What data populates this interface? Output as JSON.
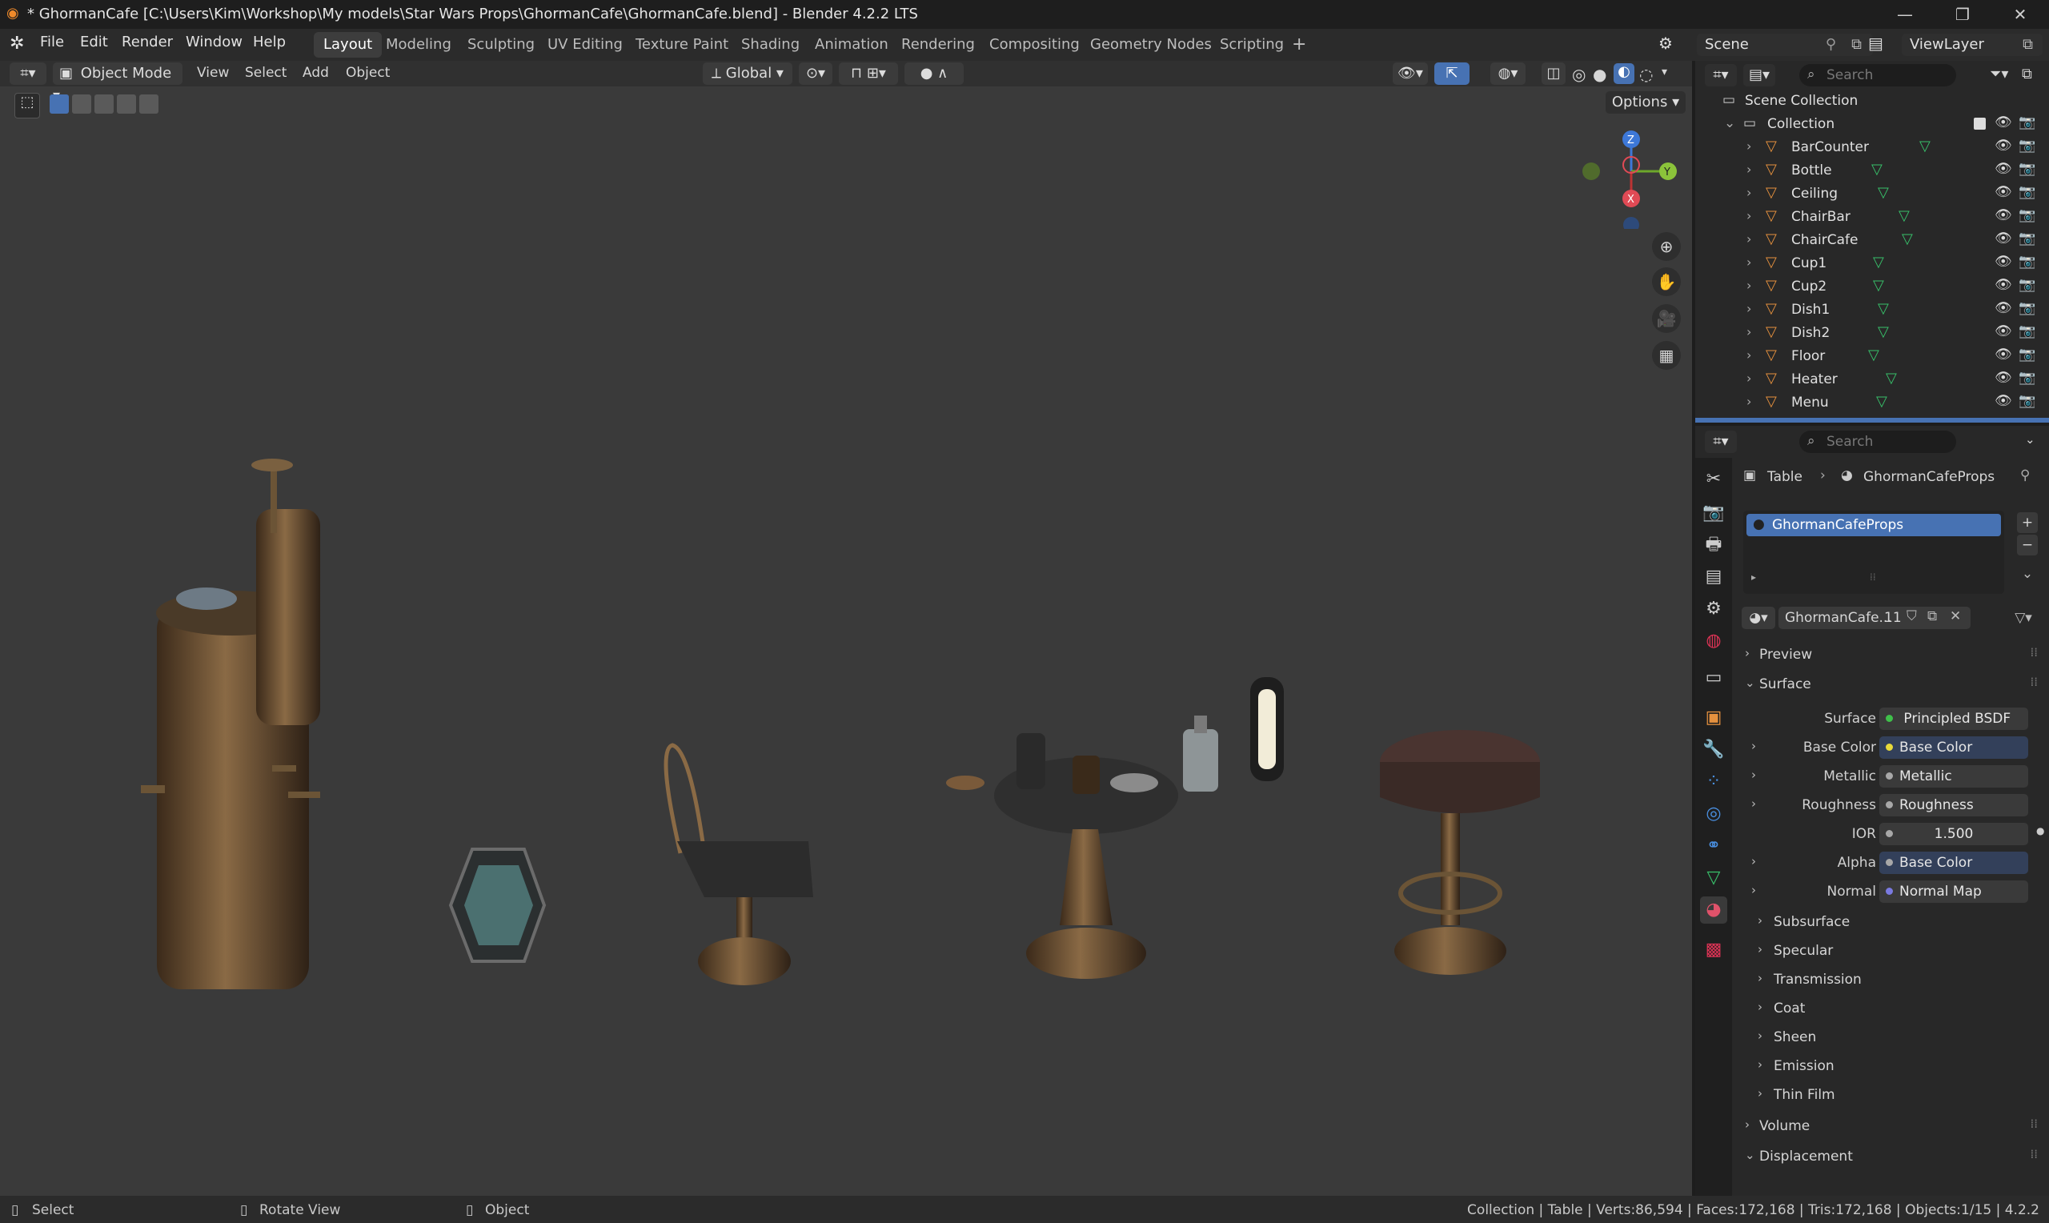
{
  "window": {
    "title": "* GhormanCafe [C:\\Users\\Kim\\Workshop\\My models\\Star Wars Props\\GhormanCafe\\GhormanCafe.blend] - Blender 4.2.2 LTS",
    "minimize": "—",
    "maximize": "❐",
    "close": "✕"
  },
  "menu": {
    "items": [
      "File",
      "Edit",
      "Render",
      "Window",
      "Help"
    ]
  },
  "workspaces": [
    "Layout",
    "Modeling",
    "Sculpting",
    "UV Editing",
    "Texture Paint",
    "Shading",
    "Animation",
    "Rendering",
    "Compositing",
    "Geometry Nodes",
    "Scripting"
  ],
  "active_workspace": "Layout",
  "add_workspace": "+",
  "scene": "Scene",
  "viewlayer": "ViewLayer",
  "viewport_header": {
    "mode": "Object Mode",
    "menus": [
      "View",
      "Select",
      "Add",
      "Object"
    ],
    "orientation": "Global",
    "options": "Options"
  },
  "gizmo": {
    "z": "Z",
    "y": "Y",
    "x": "X"
  },
  "outliner": {
    "search_placeholder": "Search",
    "scene_collection": "Scene Collection",
    "collection": "Collection",
    "objects": [
      "BarCounter",
      "Bottle",
      "Ceiling",
      "ChairBar",
      "ChairCafe",
      "Cup1",
      "Cup2",
      "Dish1",
      "Dish2",
      "Floor",
      "Heater",
      "Menu"
    ]
  },
  "properties": {
    "search_placeholder": "Search",
    "breadcrumb_object": "Table",
    "breadcrumb_material": "GhormanCafeProps",
    "slot_name": "GhormanCafeProps",
    "material_field": "GhormanCafe...",
    "user_count": "11",
    "preview_label": "Preview",
    "surface_section": "Surface",
    "surface": {
      "name": "Surface",
      "value": "Principled BSDF",
      "dot": "#3fc04a"
    },
    "inputs": [
      {
        "name": "Base Color",
        "value": "Base Color",
        "dot": "#e8d93a",
        "expandable": true,
        "linked": true
      },
      {
        "name": "Metallic",
        "value": "Metallic",
        "dot": "#a8a8a8",
        "expandable": true,
        "linked": false
      },
      {
        "name": "Roughness",
        "value": "Roughness",
        "dot": "#a8a8a8",
        "expandable": true,
        "linked": false
      },
      {
        "name": "IOR",
        "value": "1.500",
        "dot": "#a8a8a8",
        "expandable": false,
        "linked": false
      },
      {
        "name": "Alpha",
        "value": "Base Color",
        "dot": "#a8a8a8",
        "expandable": true,
        "linked": true
      },
      {
        "name": "Normal",
        "value": "Normal Map",
        "dot": "#7a7ae0",
        "expandable": true,
        "linked": false
      }
    ],
    "subsections": [
      "Subsurface",
      "Specular",
      "Transmission",
      "Coat",
      "Sheen",
      "Emission",
      "Thin Film"
    ],
    "volume": "Volume",
    "displacement": "Displacement"
  },
  "status": {
    "select": "Select",
    "rotate": "Rotate View",
    "object": "Object",
    "info": "Collection | Table | Verts:86,594 | Faces:172,168 | Tris:172,168 | Objects:1/15 | 4.2.2"
  },
  "colors": {
    "viewport_bg": "#3a3a3a",
    "accent_blue": "#4772b3",
    "header_bg": "#303030"
  }
}
